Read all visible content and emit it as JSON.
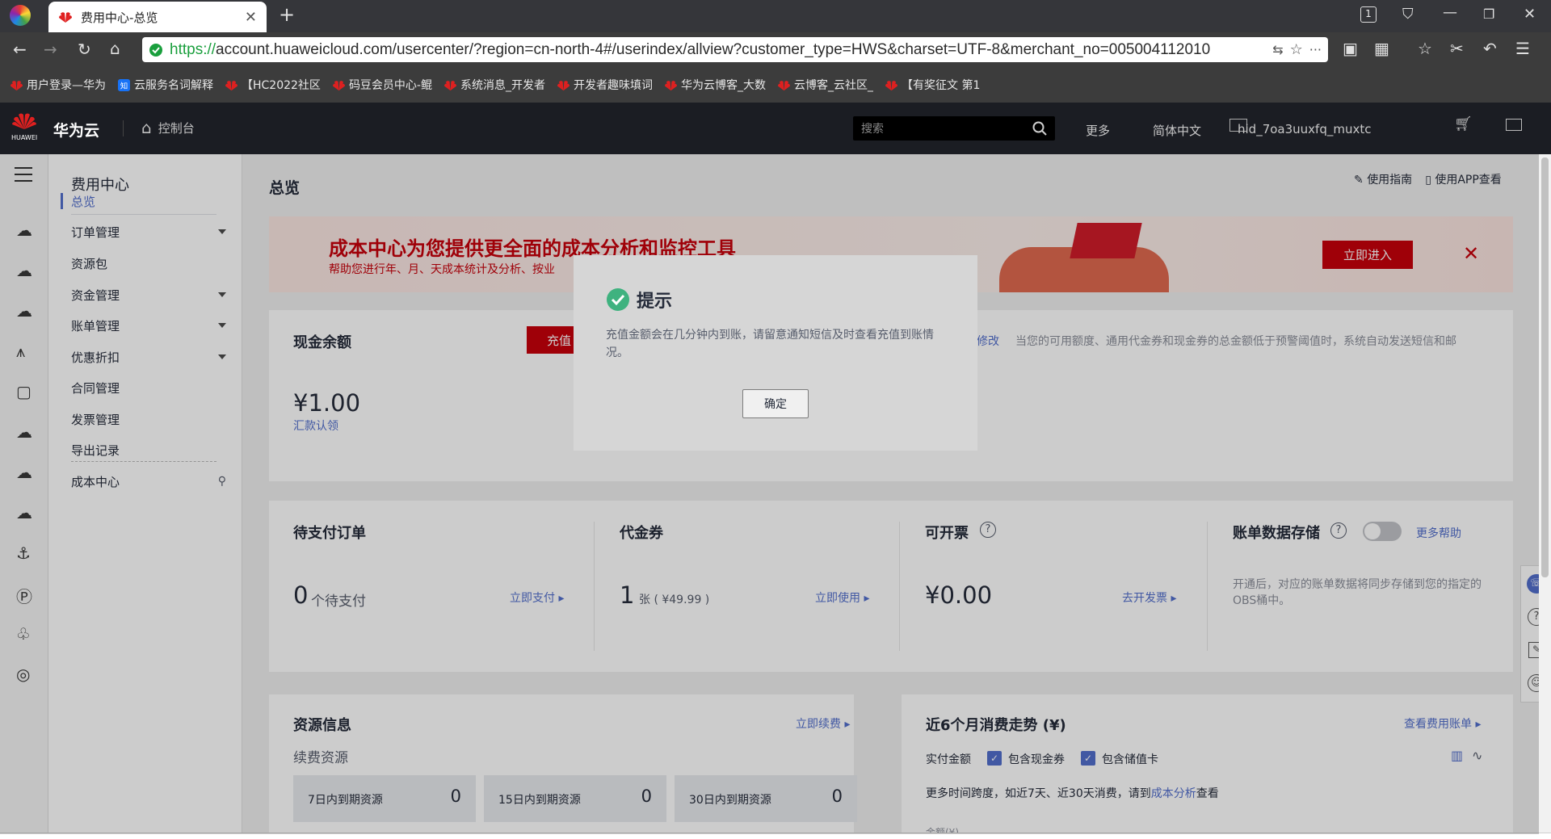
{
  "browser": {
    "tab_title": "费用中心-总览",
    "tab_count": "1",
    "url_protocol": "https://",
    "url_rest": "account.huaweicloud.com/usercenter/?region=cn-north-4#/userindex/allview?customer_type=HWS&charset=UTF-8&merchant_no=005004112010",
    "bookmarks": [
      "用户登录—华为",
      "云服务名词解释",
      "【HC2022社区",
      "码豆会员中心-鲲",
      "系统消息_开发者",
      "开发者趣味填词",
      "华为云博客_大数",
      "云博客_云社区_",
      "【有奖征文 第1"
    ]
  },
  "header": {
    "logo_text": "华为云",
    "logo_small": "HUAWEI",
    "console": "控制台",
    "search_placeholder": "搜索",
    "more": "更多",
    "language": "简体中文",
    "username": "hid_7oa3uuxfq_muxtc"
  },
  "sidebar": {
    "title": "费用中心",
    "items": [
      {
        "label": "总览"
      },
      {
        "label": "订单管理"
      },
      {
        "label": "资源包"
      },
      {
        "label": "资金管理"
      },
      {
        "label": "账单管理"
      },
      {
        "label": "优惠折扣"
      },
      {
        "label": "合同管理"
      },
      {
        "label": "发票管理"
      },
      {
        "label": "导出记录"
      },
      {
        "label": "成本中心"
      }
    ]
  },
  "page": {
    "title": "总览",
    "guide_link": "使用指南",
    "app_link": "使用APP查看"
  },
  "banner": {
    "headline": "成本中心为您提供更全面的成本分析和监控工具",
    "subline": "帮助您进行年、月、天成本统计及分析、按业",
    "enter_button": "立即进入"
  },
  "cash": {
    "title": "现金余额",
    "recharge_button": "充值",
    "amount": "¥1.00",
    "remit_link": "汇款认领",
    "modify_link": "修改",
    "alert_text": "当您的可用额度、通用代金券和现金券的总金额低于预警阈值时，系统自动发送短信和邮"
  },
  "stats": {
    "pending": {
      "title": "待支付订单",
      "value": "0",
      "unit": "个待支付",
      "link": "立即支付"
    },
    "voucher": {
      "title": "代金券",
      "value": "1",
      "unit": "张 ( ¥49.99 )",
      "link": "立即使用"
    },
    "invoice": {
      "title": "可开票",
      "value": "¥0.00",
      "link": "去开发票"
    },
    "storage": {
      "title": "账单数据存储",
      "help_link": "更多帮助",
      "desc": "开通后，对应的账单数据将同步存储到您的指定的OBS桶中。"
    }
  },
  "resources": {
    "title": "资源信息",
    "renew_link": "立即续费",
    "subtitle": "续费资源",
    "boxes": [
      {
        "label": "7日内到期资源",
        "value": "0"
      },
      {
        "label": "15日内到期资源",
        "value": "0"
      },
      {
        "label": "30日内到期资源",
        "value": "0"
      }
    ]
  },
  "trend": {
    "title": "近6个月消费走势 (¥)",
    "bill_link": "查看费用账单",
    "actual_label": "实付金额",
    "check1": "包含现金券",
    "check2": "包含储值卡",
    "note_prefix": "更多时间跨度，如近7天、近30天消费，请到",
    "note_link": "成本分析",
    "note_suffix": "查看",
    "amount_label": "金额(¥)"
  },
  "modal": {
    "title": "提示",
    "body": "充值金额会在几分钟内到账，请留意通知短信及时查看充值到账情况。",
    "ok": "确定"
  },
  "colors": {
    "brand_red": "#c7000b",
    "link_blue": "#526ecc",
    "success_green": "#3fb27f",
    "header_bg": "#1b1d23"
  }
}
